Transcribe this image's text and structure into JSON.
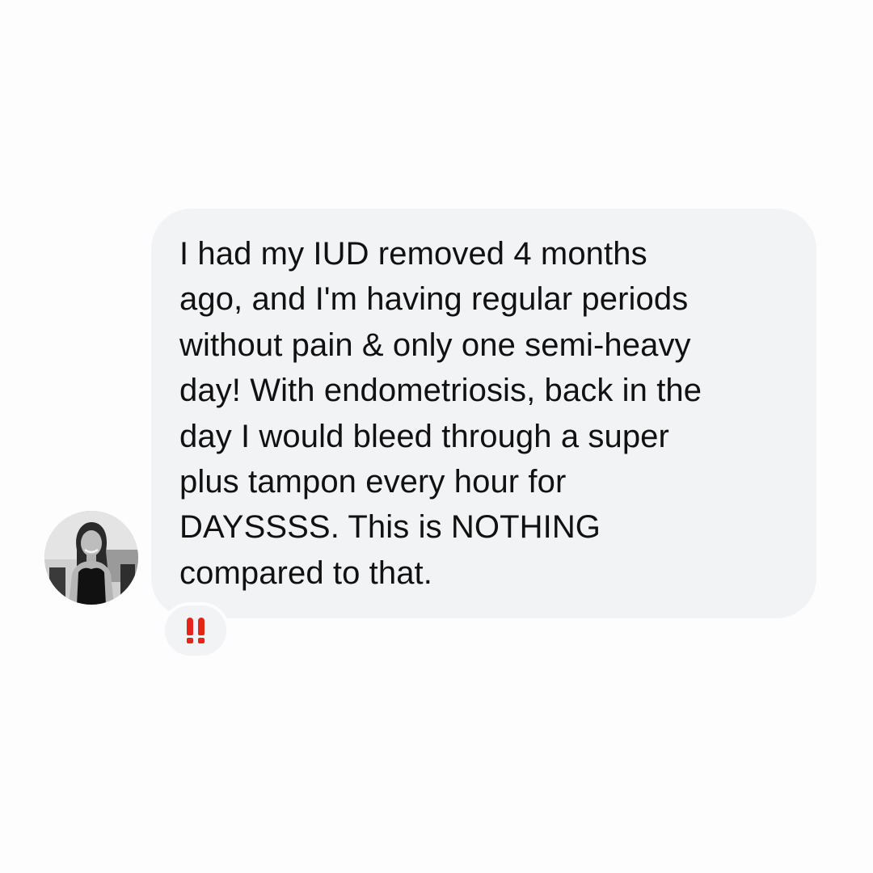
{
  "message": {
    "lines": [
      "I had my IUD removed 4 months",
      "ago, and I'm having regular periods",
      "without pain & only one semi-heavy",
      "day! With endometriosis, back in the",
      "day I would bleed through a super",
      "plus tampon every hour for",
      "DAYSSSS. This is NOTHING",
      "compared to that."
    ]
  },
  "reaction": {
    "emoji": "‼️",
    "icon": "double-exclamation-icon",
    "color": "#e3261c"
  },
  "avatar": {
    "icon": "profile-photo"
  },
  "colors": {
    "background": "#fdfdfd",
    "bubble": "#f2f3f5",
    "text": "#111111"
  }
}
